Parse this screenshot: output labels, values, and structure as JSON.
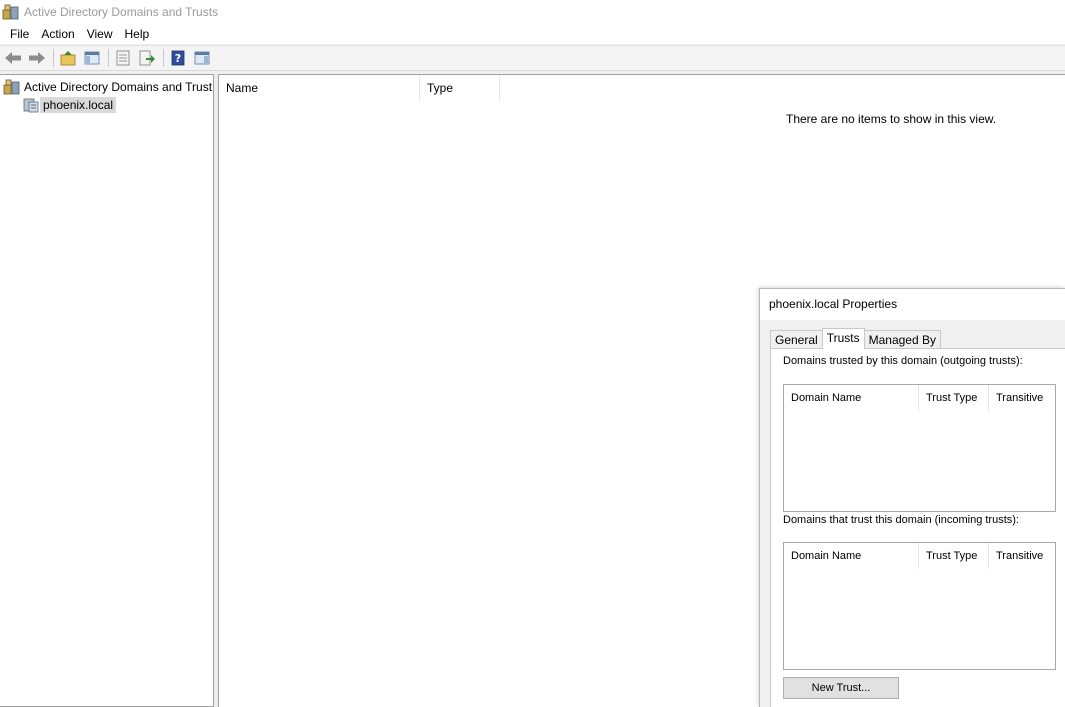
{
  "window": {
    "title": "Active Directory Domains and Trusts"
  },
  "menu": [
    "File",
    "Action",
    "View",
    "Help"
  ],
  "toolbar": {
    "buttons": [
      "back-arrow-icon",
      "forward-arrow-icon",
      "up-folder-icon",
      "show-hide-console-tree-icon",
      "properties-icon",
      "export-list-icon",
      "help-icon",
      "show-action-pane-icon"
    ]
  },
  "tree": {
    "root": {
      "label": "Active Directory Domains and Trust",
      "icon": "domains-trusts-icon"
    },
    "child": {
      "label": "phoenix.local",
      "icon": "domain-icon"
    }
  },
  "list": {
    "columns": [
      "Name",
      "Type"
    ],
    "empty_message": "There are no items to show in this view."
  },
  "dialog": {
    "title": "phoenix.local Properties",
    "tabs": [
      {
        "label": "General",
        "active": false
      },
      {
        "label": "Trusts",
        "active": true
      },
      {
        "label": "Managed By",
        "active": false
      }
    ],
    "outgoing_label": "Domains trusted by this domain (outgoing trusts):",
    "incoming_label": "Domains that trust this domain (incoming trusts):",
    "columns": [
      "Domain Name",
      "Trust Type",
      "Transitive"
    ],
    "new_trust_label": "New Trust..."
  },
  "colors": {
    "selection": "#d9d9d9",
    "title_text": "#9a9a9a",
    "border": "#a0a0a0"
  }
}
